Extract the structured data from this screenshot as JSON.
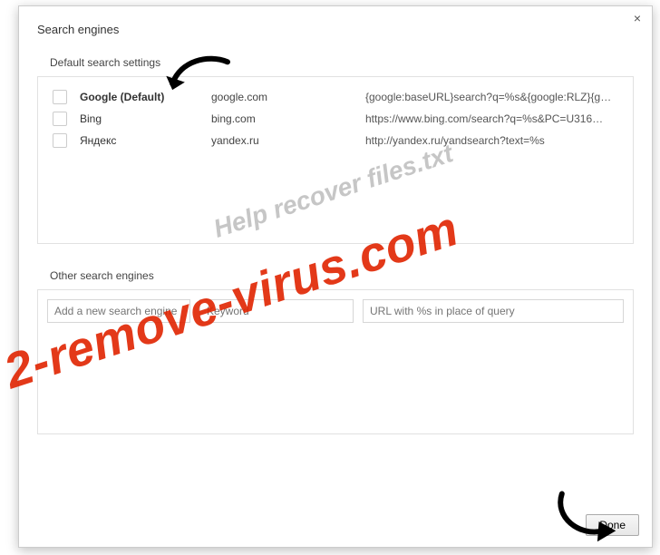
{
  "dialog": {
    "title": "Search engines",
    "close_glyph": "×",
    "done_label": "Done"
  },
  "default_section": {
    "label": "Default search settings",
    "engines": [
      {
        "name": "Google (Default)",
        "domain": "google.com",
        "url": "{google:baseURL}search?q=%s&{google:RLZ}{g…",
        "bold": true
      },
      {
        "name": "Bing",
        "domain": "bing.com",
        "url": "https://www.bing.com/search?q=%s&PC=U316…",
        "bold": false
      },
      {
        "name": "Яндекс",
        "domain": "yandex.ru",
        "url": "http://yandex.ru/yandsearch?text=%s",
        "bold": false
      }
    ]
  },
  "other_section": {
    "label": "Other search engines",
    "name_placeholder": "Add a new search engine",
    "keyword_placeholder": "Keyword",
    "url_placeholder": "URL with %s in place of query"
  },
  "watermarks": {
    "gray": "Help recover files.txt",
    "red": "2-remove-virus.com"
  }
}
